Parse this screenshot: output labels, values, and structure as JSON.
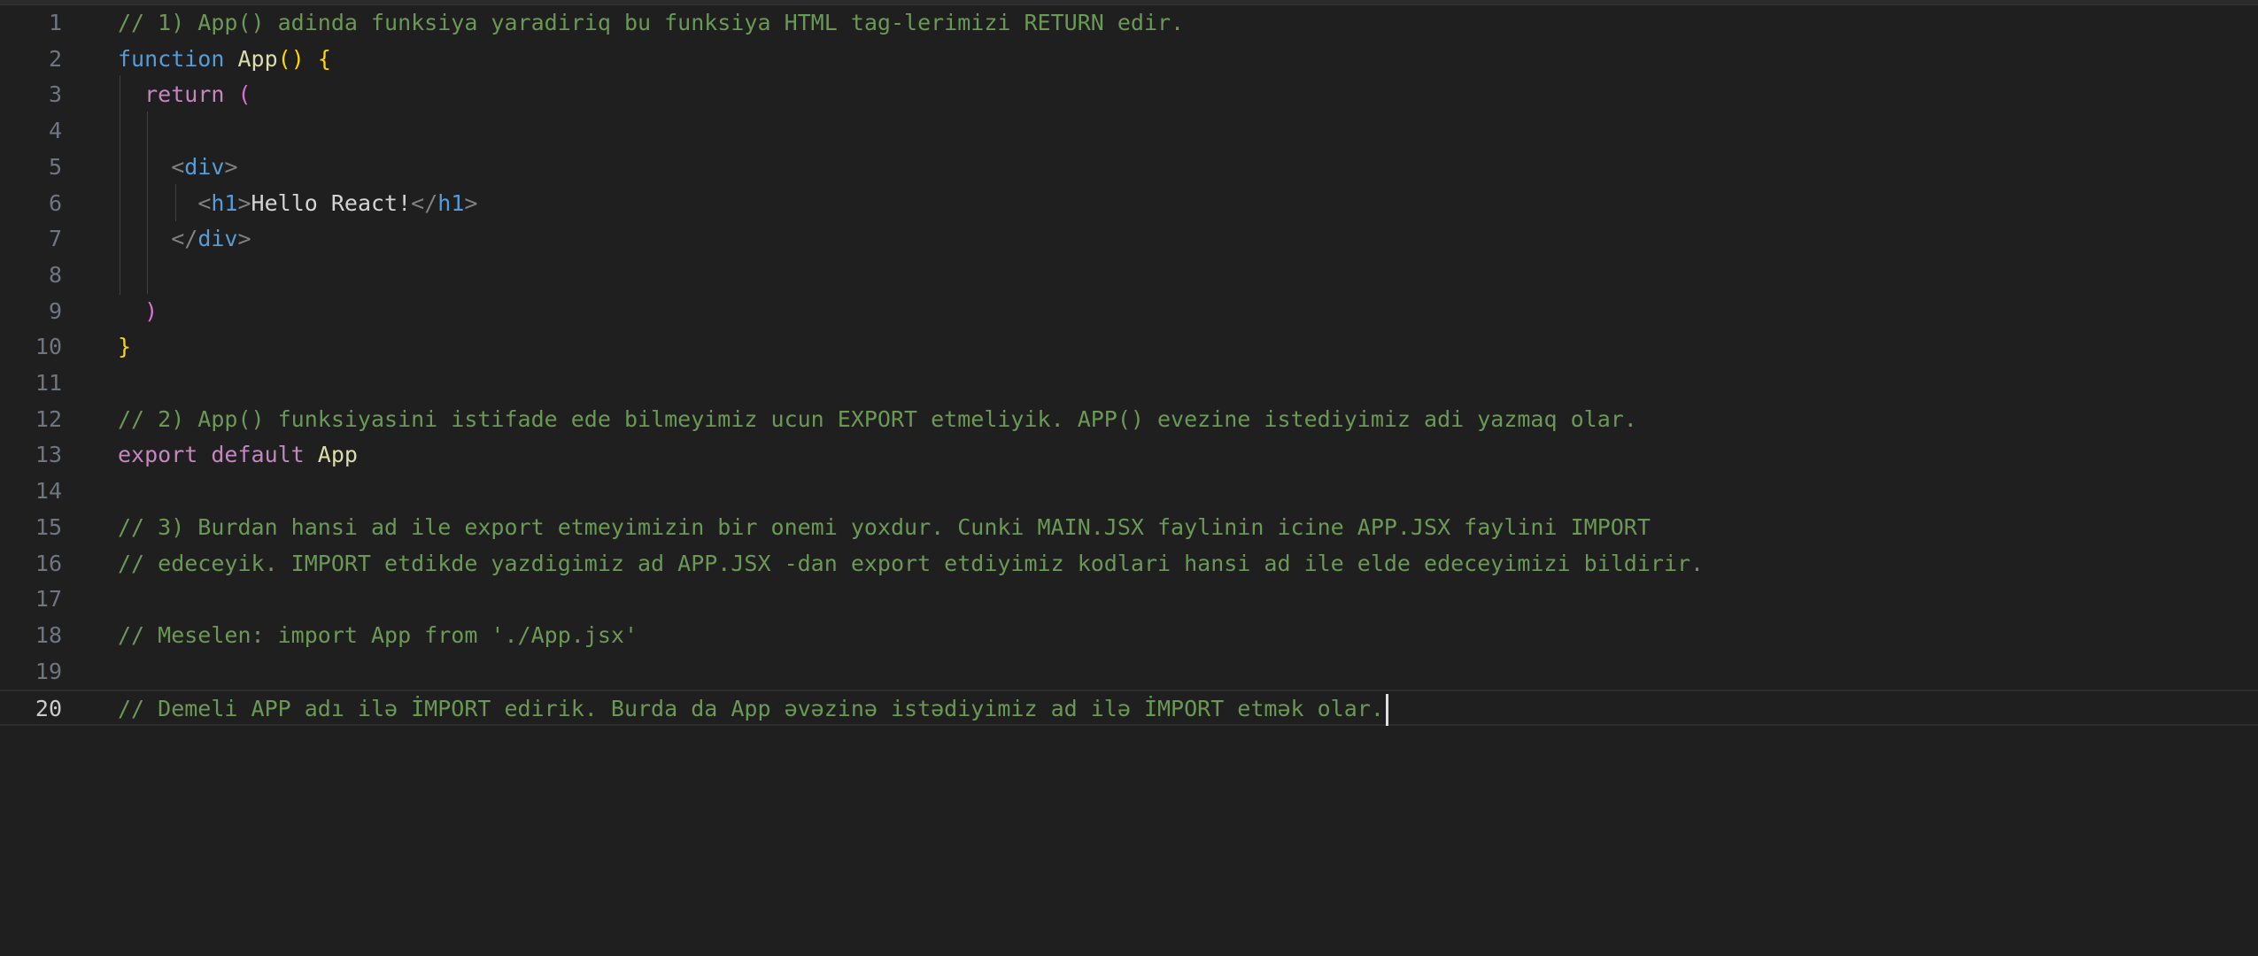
{
  "editor": {
    "active_line": "20",
    "lines": [
      {
        "n": "1",
        "tokens": [
          {
            "t": "// 1) App() adinda funksiya yaradiriq bu funksiya HTML tag-lerimizi RETURN edir.",
            "k": "comment"
          }
        ]
      },
      {
        "n": "2",
        "tokens": [
          {
            "t": "function",
            "k": "keyword"
          },
          {
            "t": " ",
            "k": "text"
          },
          {
            "t": "App",
            "k": "func"
          },
          {
            "t": "()",
            "k": "brace"
          },
          {
            "t": " ",
            "k": "text"
          },
          {
            "t": "{",
            "k": "brace"
          }
        ]
      },
      {
        "n": "3",
        "tokens": [
          {
            "t": "  ",
            "k": "text"
          },
          {
            "t": "return",
            "k": "control"
          },
          {
            "t": " ",
            "k": "text"
          },
          {
            "t": "(",
            "k": "paren2"
          }
        ]
      },
      {
        "n": "4",
        "tokens": []
      },
      {
        "n": "5",
        "tokens": [
          {
            "t": "    ",
            "k": "text"
          },
          {
            "t": "<",
            "k": "tagpunct"
          },
          {
            "t": "div",
            "k": "tag"
          },
          {
            "t": ">",
            "k": "tagpunct"
          }
        ]
      },
      {
        "n": "6",
        "tokens": [
          {
            "t": "      ",
            "k": "text"
          },
          {
            "t": "<",
            "k": "tagpunct"
          },
          {
            "t": "h1",
            "k": "tag"
          },
          {
            "t": ">",
            "k": "tagpunct"
          },
          {
            "t": "Hello React!",
            "k": "text"
          },
          {
            "t": "</",
            "k": "tagpunct"
          },
          {
            "t": "h1",
            "k": "tag"
          },
          {
            "t": ">",
            "k": "tagpunct"
          }
        ]
      },
      {
        "n": "7",
        "tokens": [
          {
            "t": "    ",
            "k": "text"
          },
          {
            "t": "</",
            "k": "tagpunct"
          },
          {
            "t": "div",
            "k": "tag"
          },
          {
            "t": ">",
            "k": "tagpunct"
          }
        ]
      },
      {
        "n": "8",
        "tokens": []
      },
      {
        "n": "9",
        "tokens": [
          {
            "t": "  ",
            "k": "text"
          },
          {
            "t": ")",
            "k": "paren2"
          }
        ]
      },
      {
        "n": "10",
        "tokens": [
          {
            "t": "}",
            "k": "brace"
          }
        ]
      },
      {
        "n": "11",
        "tokens": []
      },
      {
        "n": "12",
        "tokens": [
          {
            "t": "// 2) App() funksiyasini istifade ede bilmeyimiz ucun EXPORT etmeliyik. APP() evezine istediyimiz adi yazmaq olar.",
            "k": "comment"
          }
        ]
      },
      {
        "n": "13",
        "tokens": [
          {
            "t": "export",
            "k": "control"
          },
          {
            "t": " ",
            "k": "text"
          },
          {
            "t": "default",
            "k": "control"
          },
          {
            "t": " ",
            "k": "text"
          },
          {
            "t": "App",
            "k": "func"
          }
        ]
      },
      {
        "n": "14",
        "tokens": []
      },
      {
        "n": "15",
        "tokens": [
          {
            "t": "// 3) Burdan hansi ad ile export etmeyimizin bir onemi yoxdur. Cunki MAIN.JSX faylinin icine APP.JSX faylini IMPORT",
            "k": "comment"
          }
        ]
      },
      {
        "n": "16",
        "tokens": [
          {
            "t": "// edeceyik. IMPORT etdikde yazdigimiz ad APP.JSX -dan export etdiyimiz kodlari hansi ad ile elde edeceyimizi bildirir.",
            "k": "comment"
          }
        ]
      },
      {
        "n": "17",
        "tokens": []
      },
      {
        "n": "18",
        "tokens": [
          {
            "t": "// Meselen: import App from './App.jsx'",
            "k": "comment"
          }
        ]
      },
      {
        "n": "19",
        "tokens": []
      },
      {
        "n": "20",
        "tokens": [
          {
            "t": "// Demeli APP adı ilə İMPORT edirik. Burda da App əvəzinə istədiyimiz ad ilə İMPORT etmək olar.",
            "k": "comment"
          }
        ]
      }
    ]
  }
}
